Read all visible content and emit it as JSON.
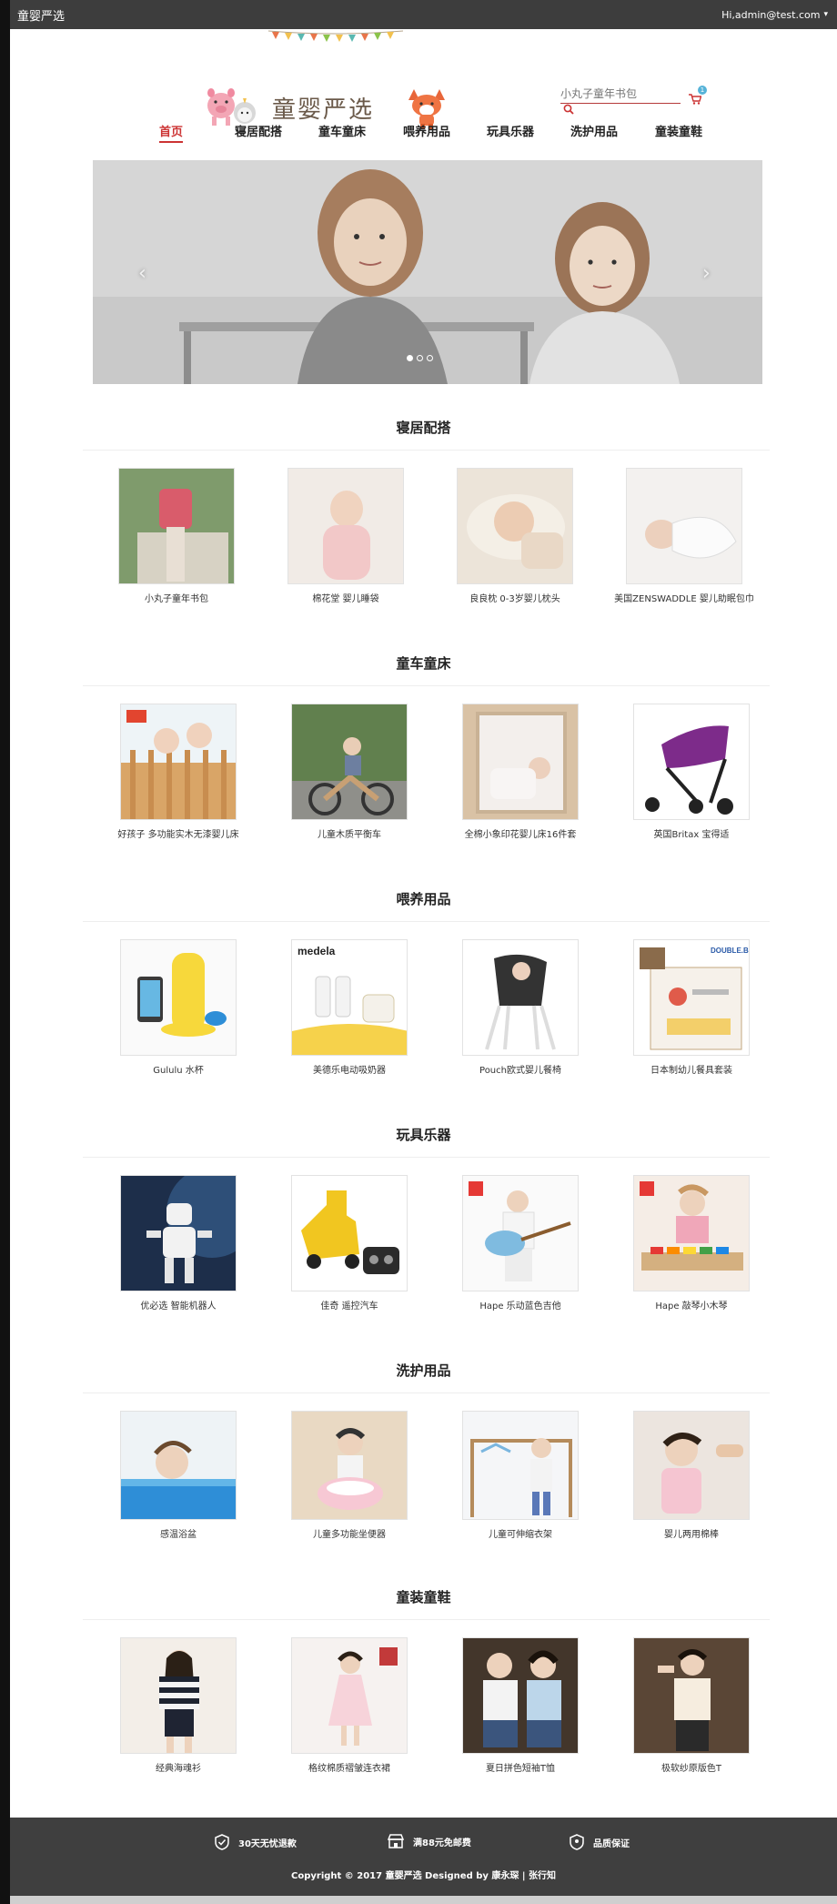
{
  "topbar": {
    "site_name": "童婴严选",
    "user": "Hi,admin@test.com"
  },
  "header": {
    "logo_text": "童婴严选",
    "search_placeholder": "小丸子童年书包",
    "cart_count": "1"
  },
  "nav": {
    "items": [
      "首页",
      "寝居配搭",
      "童车童床",
      "喂养用品",
      "玩具乐器",
      "洗护用品",
      "童装童鞋"
    ],
    "active_index": 0
  },
  "banner": {
    "slide_count": 3,
    "active_slide": 1
  },
  "sections": [
    {
      "title": "寝居配搭",
      "products": [
        "小丸子童年书包",
        "棉花堂 婴儿睡袋",
        "良良枕 0-3岁婴儿枕头",
        "美国ZENSWADDLE 婴儿助眠包巾"
      ]
    },
    {
      "title": "童车童床",
      "products": [
        "好孩子 多功能实木无漆婴儿床",
        "儿童木质平衡车",
        "全棉小象印花婴儿床16件套",
        "英国Britax 宝得适"
      ]
    },
    {
      "title": "喂养用品",
      "products": [
        "Gululu 水杯",
        "美德乐电动吸奶器",
        "Pouch欧式婴儿餐椅",
        "日本制幼儿餐具套装"
      ]
    },
    {
      "title": "玩具乐器",
      "products": [
        "优必选 智能机器人",
        "佳奇 遥控汽车",
        "Hape 乐动蓝色吉他",
        "Hape 敲琴小木琴"
      ]
    },
    {
      "title": "洗护用品",
      "products": [
        "感温浴盆",
        "儿童多功能坐便器",
        "儿童可伸缩衣架",
        "婴儿两用棉棒"
      ]
    },
    {
      "title": "童装童鞋",
      "products": [
        "经典海魂衫",
        "格纹棉质褶皱连衣裙",
        "夏日拼色短袖T恤",
        "极软纱原版色T"
      ]
    }
  ],
  "footer": {
    "perks": [
      "30天无忧退款",
      "满88元免邮费",
      "品质保证"
    ],
    "copyright": "Copyright © 2017 童婴严选 Designed by 康永琛 | 张行知"
  },
  "colors": {
    "topbar": "#3d3d3d",
    "accent": "#c33333",
    "footer": "#3f3f3f"
  }
}
